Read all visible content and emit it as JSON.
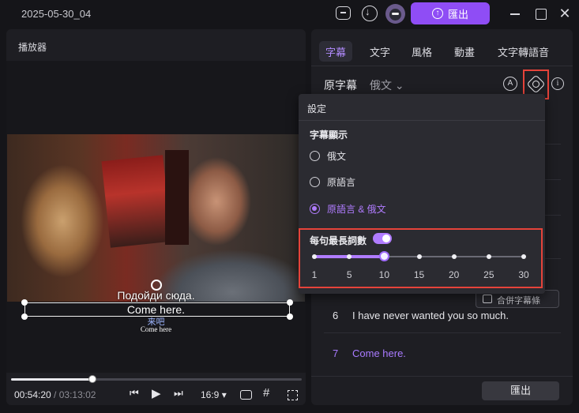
{
  "window": {
    "project_title": "2025-05-30_04",
    "export_label": "匯出",
    "close_glyph": "✕"
  },
  "player": {
    "title": "播放器",
    "subtitle_ru": "Подойди сюда.",
    "subtitle_en": "Come here.",
    "burned_zh": "来吧",
    "burned_en": "Come here",
    "current_time": "00:54:20",
    "total_time": " / 03:13:02",
    "progress_fraction": 0.281,
    "aspect_ratio": "16:9 ▾",
    "prev_glyph": "⏮",
    "play_glyph": "▶",
    "next_glyph": "⏭",
    "grid_glyph": "#"
  },
  "panel": {
    "tabs": [
      {
        "label": "字幕",
        "active": true
      },
      {
        "label": "文字",
        "active": false
      },
      {
        "label": "風格",
        "active": false
      },
      {
        "label": "動畫",
        "active": false
      },
      {
        "label": "文字轉語音",
        "active": false
      }
    ],
    "original_label": "原字幕",
    "language": "俄文 ⌄",
    "merge_label": "合併字幕條",
    "rows": [
      {
        "num": "6",
        "text": "I have never wanted you so much.",
        "highlight": false
      },
      {
        "num": "7",
        "text": "Come here.",
        "highlight": true
      }
    ],
    "export_label": "匯出"
  },
  "settings_popup": {
    "title": "設定",
    "display_label": "字幕顯示",
    "options": [
      {
        "label": "俄文",
        "selected": false
      },
      {
        "label": "原語言",
        "selected": false
      },
      {
        "label": "原語言 & 俄文",
        "selected": true
      }
    ],
    "max_length_label": "每句最長詞數",
    "max_length_enabled": true,
    "slider_ticks": [
      "1",
      "5",
      "10",
      "15",
      "20",
      "25",
      "30"
    ],
    "slider_value": "10"
  },
  "colors": {
    "accent": "#8f4df5",
    "highlight": "#b07cff",
    "alert_outline": "#e5433a"
  }
}
